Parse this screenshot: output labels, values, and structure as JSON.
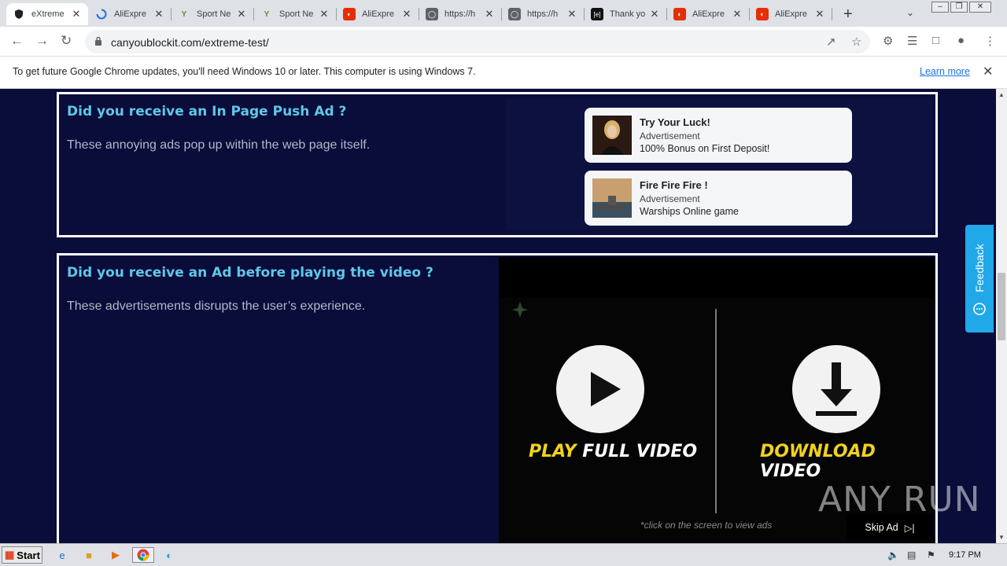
{
  "browser": {
    "tabs": [
      {
        "title": "eXtreme",
        "icon": "shield-icon",
        "active": true
      },
      {
        "title": "AliExpre",
        "icon": "loading-spinner-icon",
        "active": false
      },
      {
        "title": "Sport Ne",
        "icon": "y-logo-icon",
        "active": false
      },
      {
        "title": "Sport Ne",
        "icon": "y-logo-icon",
        "active": false
      },
      {
        "title": "AliExpre",
        "icon": "aliexpress-icon",
        "active": false
      },
      {
        "title": "https://h",
        "icon": "globe-icon",
        "active": false
      },
      {
        "title": "https://h",
        "icon": "globe-icon",
        "active": false
      },
      {
        "title": "Thank yo",
        "icon": "site-logo-icon",
        "active": false
      },
      {
        "title": "AliExpre",
        "icon": "aliexpress-icon",
        "active": false
      },
      {
        "title": "AliExpre",
        "icon": "aliexpress-icon",
        "active": false
      }
    ],
    "url": "canyoublockit.com/extreme-test/"
  },
  "infobar": {
    "message": "To get future Google Chrome updates, you'll need Windows 10 or later. This computer is using Windows 7.",
    "link": "Learn more"
  },
  "sections": {
    "push": {
      "title": "Did you receive an In Page Push Ad ?",
      "description": "These annoying ads pop up within the web page itself.",
      "ads": [
        {
          "title": "Try Your Luck!",
          "label": "Advertisement",
          "body": "100% Bonus on First Deposit!"
        },
        {
          "title": "Fire Fire Fire !",
          "label": "Advertisement",
          "body": "Warships Online game"
        }
      ]
    },
    "video": {
      "title": "Did you receive an Ad before playing the video ?",
      "description": "These advertisements disrupts the user’s experience.",
      "play_yellow": "PLAY",
      "play_white": "FULL VIDEO",
      "download_yellow": "DOWNLOAD",
      "download_white": "VIDEO",
      "hint": "*click on the screen to view ads",
      "skip": "Skip Ad"
    }
  },
  "feedback": "Feedback",
  "watermark": "ANY RUN",
  "taskbar": {
    "start": "Start",
    "clock": "9:17 PM"
  },
  "colors": {
    "page_bg": "#0a0c3a",
    "title": "#5ec8e8",
    "feedback": "#20a8e8",
    "video_yellow": "#f2d21c"
  }
}
